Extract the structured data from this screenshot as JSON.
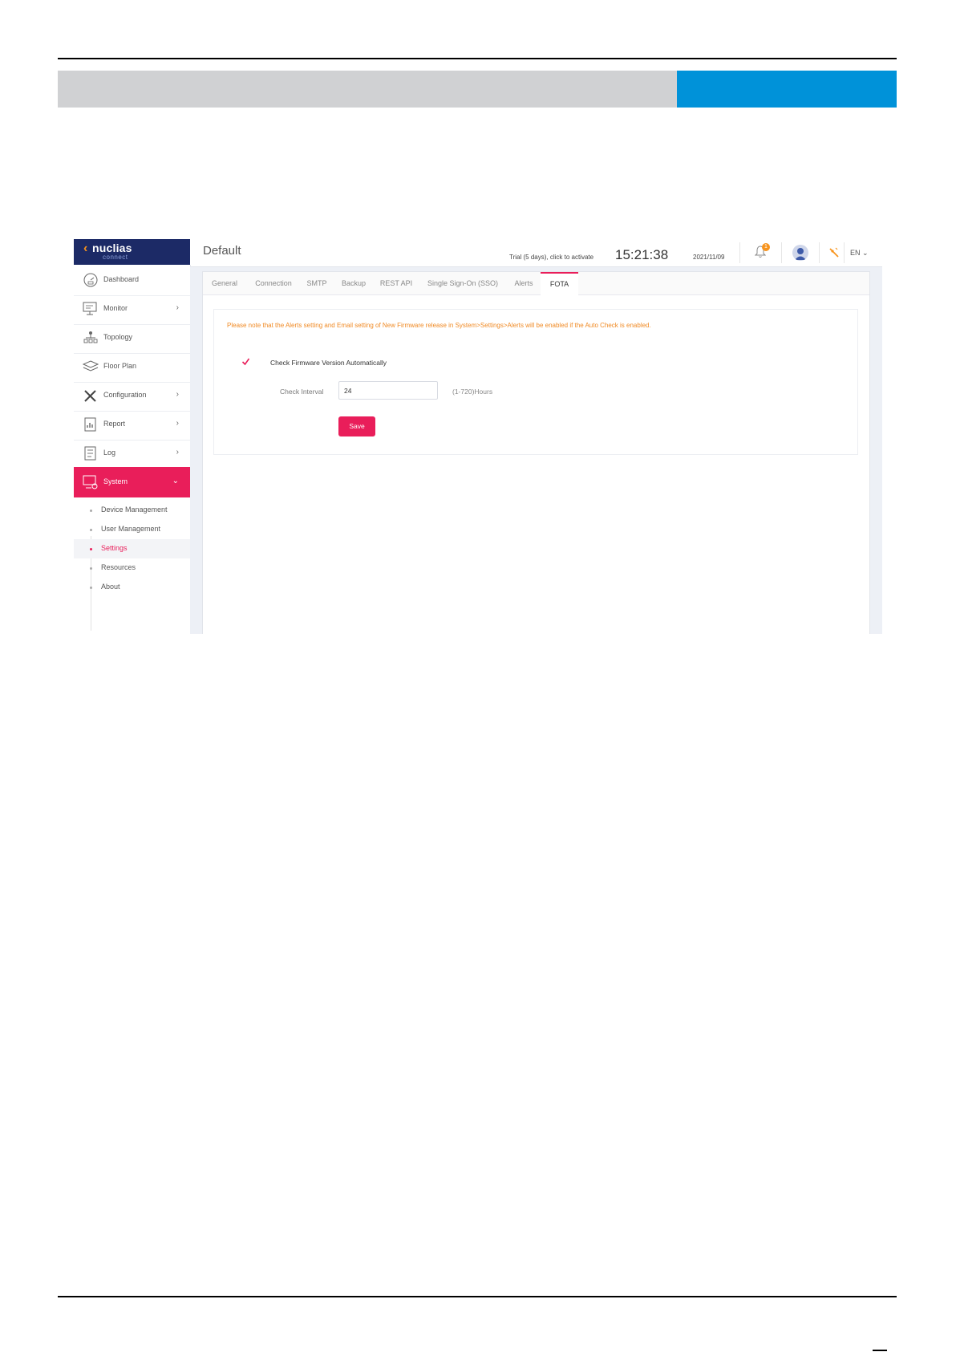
{
  "app": {
    "logo_text": "nuclias",
    "logo_sub": "connect",
    "page_title": "Default",
    "trial_text": "Trial (5 days), click to activate",
    "time": "15:21:38",
    "date": "2021/11/09",
    "notification_count": "1",
    "language": "EN"
  },
  "sidebar": {
    "items": [
      {
        "label": "Dashboard",
        "icon": "dashboard-icon",
        "arrow": ""
      },
      {
        "label": "Monitor",
        "icon": "monitor-icon",
        "arrow": "›"
      },
      {
        "label": "Topology",
        "icon": "topology-icon",
        "arrow": ""
      },
      {
        "label": "Floor Plan",
        "icon": "floor-plan-icon",
        "arrow": ""
      },
      {
        "label": "Configuration",
        "icon": "configuration-icon",
        "arrow": "›"
      },
      {
        "label": "Report",
        "icon": "report-icon",
        "arrow": "›"
      },
      {
        "label": "Log",
        "icon": "log-icon",
        "arrow": "›"
      },
      {
        "label": "System",
        "icon": "system-icon",
        "arrow": "⌄"
      }
    ],
    "subitems": [
      {
        "label": "Device Management"
      },
      {
        "label": "User Management"
      },
      {
        "label": "Settings"
      },
      {
        "label": "Resources"
      },
      {
        "label": "About"
      }
    ]
  },
  "tabs": [
    {
      "label": "General"
    },
    {
      "label": "Connection"
    },
    {
      "label": "SMTP"
    },
    {
      "label": "Backup"
    },
    {
      "label": "REST API"
    },
    {
      "label": "Single Sign-On (SSO)"
    },
    {
      "label": "Alerts"
    },
    {
      "label": "FOTA"
    }
  ],
  "fota": {
    "notice": "Please note that the Alerts setting and Email setting of New Firmware release in System>Settings>Alerts will be enabled if the Auto Check is enabled.",
    "check_label": "Check Firmware Version Automatically",
    "check_enabled": true,
    "interval_label": "Check Interval",
    "interval_value": "24",
    "interval_hint": "(1-720)Hours",
    "save_label": "Save"
  },
  "colors": {
    "accent": "#e91e5a",
    "navy": "#1c2a66",
    "orange": "#f7941e",
    "banner_gray": "#d0d1d3",
    "banner_blue": "#0092d9"
  }
}
